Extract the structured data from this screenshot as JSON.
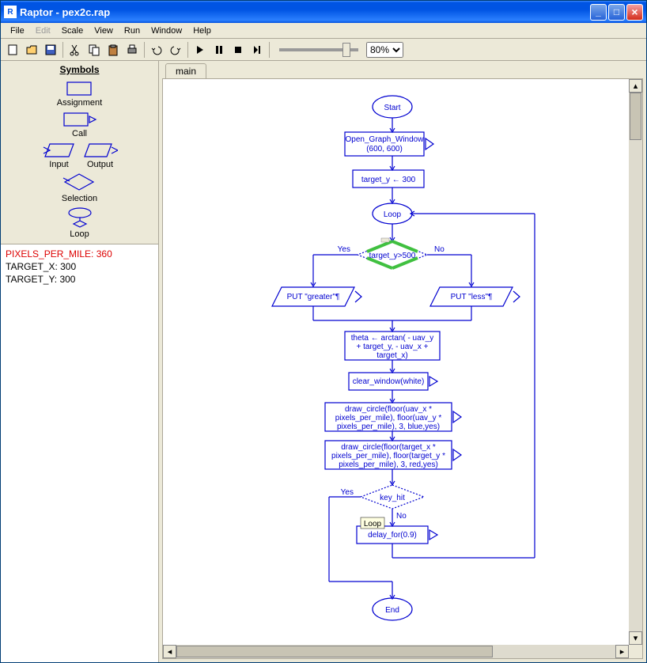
{
  "title": "Raptor - pex2c.rap",
  "menu": {
    "file": "File",
    "edit": "Edit",
    "scale": "Scale",
    "view": "View",
    "run": "Run",
    "window": "Window",
    "help": "Help"
  },
  "zoom": "80%",
  "symbols": {
    "title": "Symbols",
    "assignment": "Assignment",
    "call": "Call",
    "input": "Input",
    "output": "Output",
    "selection": "Selection",
    "loop": "Loop"
  },
  "vars": [
    {
      "text": "PIXELS_PER_MILE: 360",
      "hl": true
    },
    {
      "text": "TARGET_X: 300",
      "hl": false
    },
    {
      "text": "TARGET_Y: 300",
      "hl": false
    }
  ],
  "tab": "main",
  "flow": {
    "start": "Start",
    "open_graph": "Open_Graph_Window (600, 600)",
    "target_y": "target_y ← 300",
    "loop": "Loop",
    "cond1": "target_y>500",
    "yes": "Yes",
    "no": "No",
    "put_greater": "PUT \"greater\"¶",
    "put_less": "PUT \"less\"¶",
    "theta": "theta ← arctan( - uav_y + target_y, - uav_x + target_x)",
    "clear": "clear_window(white)",
    "draw1": "draw_circle(floor(uav_x * pixels_per_mile), floor(uav_y * pixels_per_mile), 3, blue,yes)",
    "draw2": "draw_circle(floor(target_x * pixels_per_mile), floor(target_y * pixels_per_mile), 3, red,yes)",
    "keyhit": "key_hit",
    "loop_tip": "Loop",
    "delay": "delay_for(0.9)",
    "end": "End"
  }
}
